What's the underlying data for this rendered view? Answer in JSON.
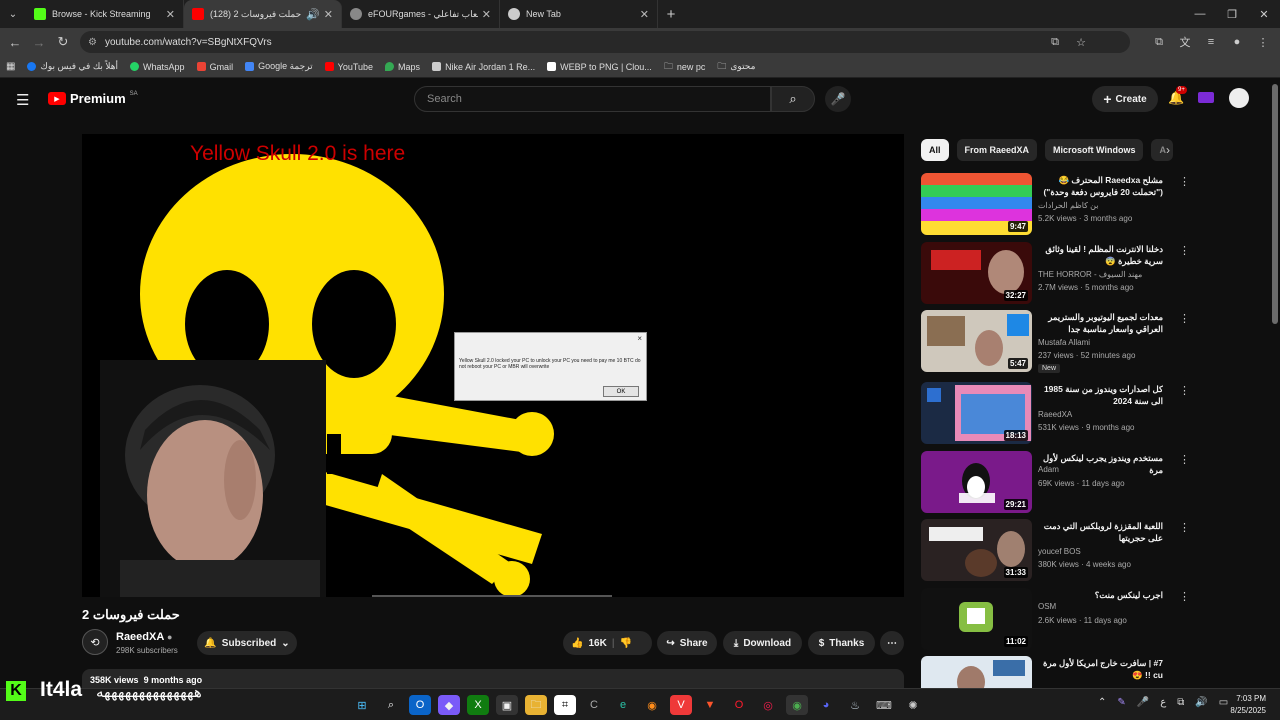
{
  "browser": {
    "tabs": [
      {
        "title": "Browse - Kick Streaming",
        "color": "#53fc18"
      },
      {
        "title": "(128) حملت فيروسات 2 - ...be",
        "color": "#ff0000"
      },
      {
        "title": "eFOURgames - ع ألعاب تفاعلي",
        "color": "#cccccc"
      },
      {
        "title": "New Tab",
        "color": "#cccccc"
      }
    ],
    "new_tab": "+",
    "url": "youtube.com/watch?v=SBgNtXFQVrs",
    "bookmarks": [
      {
        "label": "أهلاً بك في فيس بوك",
        "color": "#1877f2"
      },
      {
        "label": "WhatsApp",
        "color": "#25d366"
      },
      {
        "label": "Gmail",
        "color": "#ea4335"
      },
      {
        "label": "Google ترجمة",
        "color": "#4285f4"
      },
      {
        "label": "YouTube",
        "color": "#ff0000"
      },
      {
        "label": "Maps",
        "color": "#34a853"
      },
      {
        "label": "Nike Air Jordan 1 Re...",
        "color": "#cccccc"
      },
      {
        "label": "WEBP to PNG | Clou...",
        "color": "#ffffff"
      },
      {
        "label": "new pc",
        "color": "#888888"
      },
      {
        "label": "محتوى",
        "color": "#888888"
      }
    ]
  },
  "youtube": {
    "logo_text": "Premium",
    "region": "SA",
    "search_placeholder": "Search",
    "create_label": "Create",
    "notif_count": "9+"
  },
  "video": {
    "overlay_title": "Yellow Skull 2.0 is here",
    "dialog_close": "×",
    "dialog_message": "Yellow Skull 2.0 locked your PC to unlock your PC you need to pay me 10 BTC do not reboot your PC or MBR will overwrite",
    "dialog_ok": "OK",
    "title": "حملت فيروسات 2",
    "channel": "RaeedXA",
    "subscribers": "298K subscribers",
    "subscribed_label": "Subscribed",
    "likes": "16K",
    "share_label": "Share",
    "download_label": "Download",
    "thanks_label": "Thanks",
    "views": "358K views",
    "age": "9 months ago"
  },
  "chips": [
    "All",
    "From RaeedXA",
    "Microsoft Windows",
    "A"
  ],
  "recommendations": [
    {
      "title": "مشلح Raeedxa المحترف 😂 (\"تحملت 20 فايروس دفعة وحدة\")",
      "channel": "بن كاظم الحرادات",
      "meta": "5.2K views · 3 months ago",
      "duration": "9:47",
      "new": ""
    },
    {
      "title": "دخلنا الانترنت المظلم ! لقينا وثائق سرية خطيرة 😨",
      "channel": "THE HORROR - مهند السيوف",
      "meta": "2.7M views · 5 months ago",
      "duration": "32:27",
      "new": ""
    },
    {
      "title": "معدات لجميع اليوتيوبر والستريمر العراقي واسعار مناسبة جدا",
      "channel": "Mustafa Allami",
      "meta": "237 views · 52 minutes ago",
      "duration": "5:47",
      "new": "New"
    },
    {
      "title": "كل اصدارات ويندوز من سنة 1985 الى سنة 2024",
      "channel": "RaeedXA",
      "meta": "531K views · 9 months ago",
      "duration": "18:13",
      "new": ""
    },
    {
      "title": "مستخدم ويندوز يجرب لينكس لأول مرة",
      "channel": "Adam",
      "meta": "69K views · 11 days ago",
      "duration": "29:21",
      "new": ""
    },
    {
      "title": "اللعبة المقززة لروبلكس التي دمت على حجريتها",
      "channel": "youcef BOS",
      "meta": "380K views · 4 weeks ago",
      "duration": "31:33",
      "new": ""
    },
    {
      "title": "اجرب لينكس منت؟",
      "channel": "OSM",
      "meta": "2.6K views · 11 days ago",
      "duration": "11:02",
      "new": ""
    },
    {
      "title": "#7 | سافرت خارج امريكا لأول مرة cu !! 😍",
      "channel": "",
      "meta": "",
      "duration": "",
      "new": ""
    }
  ],
  "overlay": {
    "kick_letter": "K",
    "streamer": "It4la",
    "message": "ههههههههههههههه"
  },
  "taskbar": {
    "lang": "ع",
    "time": "7:03 PM",
    "date": "8/25/2025"
  }
}
